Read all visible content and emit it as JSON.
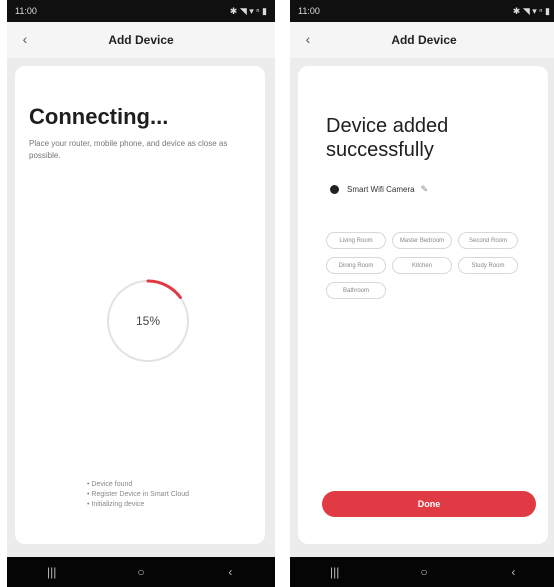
{
  "colors": {
    "accent": "#e03a44",
    "progress": "#e03a44",
    "track": "#e2e2e2"
  },
  "icons": {
    "back": "chevron-left-icon",
    "edit": "pencil-icon",
    "device": "camera-icon"
  },
  "left": {
    "status_time": "11:00",
    "status_icons": "✱ ◥ ▾ ⁿ ▮",
    "title": "Add Device",
    "back_glyph": "‹",
    "heading": "Connecting...",
    "hint": "Place your router, mobile phone, and device as close as possible.",
    "progress_label": "15%",
    "progress_fraction": 0.15,
    "steps": [
      "Device found",
      "Register Device in Smart Cloud",
      "Initializing device"
    ],
    "nav": {
      "recents": "|||",
      "home": "○",
      "back": "‹"
    }
  },
  "right": {
    "status_time": "11:00",
    "status_icons": "✱ ◥ ▾ ⁿ ▮",
    "title": "Add Device",
    "back_glyph": "‹",
    "heading": "Device added successfully",
    "device_name": "Smart Wifi Camera",
    "edit_glyph": "✎",
    "rooms": [
      "Living Room",
      "Master Bedroom",
      "Second Room",
      "Dining Room",
      "Kitchen",
      "Study Room",
      "Bathroom"
    ],
    "done_label": "Done",
    "nav": {
      "recents": "|||",
      "home": "○",
      "back": "‹"
    }
  }
}
